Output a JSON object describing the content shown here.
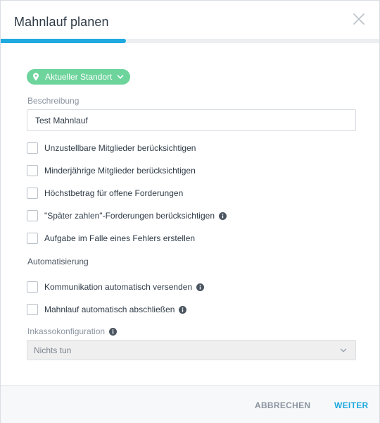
{
  "dialog": {
    "title": "Mahnlauf planen",
    "progress": 0.33,
    "accent_color": "#1fa9df",
    "location_chip_color": "#6dd49c"
  },
  "location": {
    "label": "Aktueller Standort",
    "icon": "map-pin-icon"
  },
  "description": {
    "label": "Beschreibung",
    "value": "Test Mahnlauf"
  },
  "options": [
    {
      "label": "Unzustellbare Mitglieder berücksichtigen",
      "checked": false,
      "info": false
    },
    {
      "label": "Minderjährige Mitglieder berücksichtigen",
      "checked": false,
      "info": false
    },
    {
      "label": "Höchstbetrag für offene Forderungen",
      "checked": false,
      "info": false
    },
    {
      "label": "\"Später zahlen\"-Forderungen berücksichtigen",
      "checked": false,
      "info": true
    },
    {
      "label": "Aufgabe im Falle eines Fehlers erstellen",
      "checked": false,
      "info": false
    }
  ],
  "automation": {
    "heading": "Automatisierung",
    "options": [
      {
        "label": "Kommunikation automatisch versenden",
        "checked": false,
        "info": true
      },
      {
        "label": "Mahnlauf automatisch abschließen",
        "checked": false,
        "info": true
      }
    ]
  },
  "collection": {
    "label": "Inkassokonfiguration",
    "value": "Nichts tun",
    "disabled": true
  },
  "footer": {
    "cancel_label": "ABBRECHEN",
    "next_label": "WEITER"
  }
}
